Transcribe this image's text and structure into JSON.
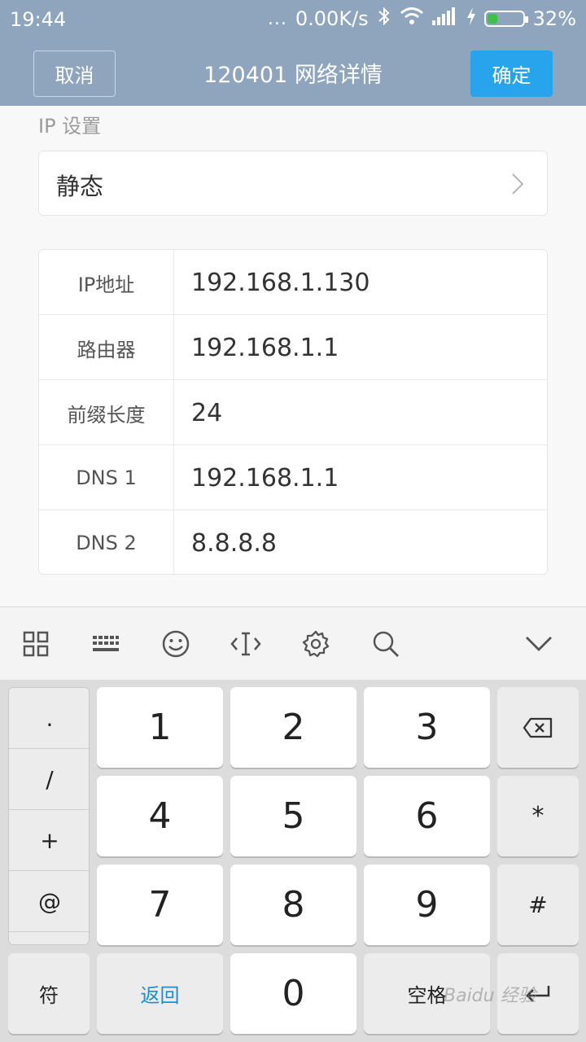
{
  "status": {
    "time": "19:44",
    "dots": "...",
    "speed": "0.00K/s",
    "battery": "32%"
  },
  "header": {
    "cancel": "取消",
    "title": "120401 网络详情",
    "confirm": "确定"
  },
  "ip_settings": {
    "label": "IP 设置",
    "mode": "静态"
  },
  "fields": [
    {
      "key": "IP地址",
      "value": "192.168.1.130"
    },
    {
      "key": "路由器",
      "value": "192.168.1.1"
    },
    {
      "key": "前缀长度",
      "value": "24"
    },
    {
      "key": "DNS 1",
      "value": "192.168.1.1"
    },
    {
      "key": "DNS 2",
      "value": "8.8.8.8"
    }
  ],
  "toolbar_icons": [
    "grid-icon",
    "keyboard-icon",
    "emoji-icon",
    "cursor-icon",
    "settings-icon",
    "search-icon",
    "collapse-icon"
  ],
  "keyboard": {
    "side": [
      ".",
      "/",
      "+",
      "@"
    ],
    "digits": [
      "1",
      "2",
      "3",
      "4",
      "5",
      "6",
      "7",
      "8",
      "9",
      "0"
    ],
    "symbol": "符",
    "back": "返回",
    "space": "空格",
    "star": "*",
    "hash": "#"
  },
  "watermark": "Baidu 经验",
  "colors": {
    "titlebar": "#8fa5bd",
    "accent": "#27a4eb"
  }
}
